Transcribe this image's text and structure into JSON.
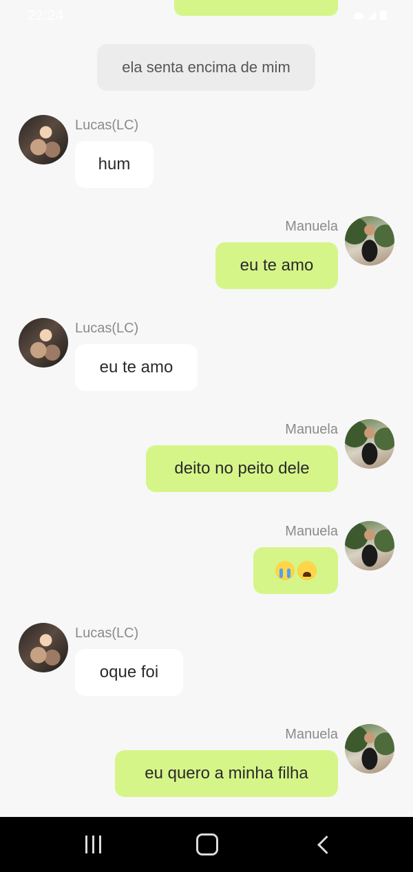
{
  "status_bar": {
    "time": "22:24",
    "icons": [
      "wifi-icon",
      "signal-icon",
      "battery-icon"
    ]
  },
  "system_message": "ela senta encima de mim",
  "messages": [
    {
      "sender": "Lucas(LC)",
      "direction": "incoming",
      "text": "hum",
      "avatar": "avatar-lucas"
    },
    {
      "sender": "Manuela",
      "direction": "outgoing",
      "text": "eu te amo",
      "avatar": "avatar-manuela"
    },
    {
      "sender": "Lucas(LC)",
      "direction": "incoming",
      "text": "eu te amo",
      "avatar": "avatar-lucas"
    },
    {
      "sender": "Manuela",
      "direction": "outgoing",
      "text": "deito no peito dele",
      "avatar": "avatar-manuela"
    },
    {
      "sender": "Manuela",
      "direction": "outgoing",
      "text": "😭😫",
      "emojis": [
        "loudly-crying-face-icon",
        "tired-face-icon"
      ],
      "avatar": "avatar-manuela"
    },
    {
      "sender": "Lucas(LC)",
      "direction": "incoming",
      "text": "oque foi",
      "avatar": "avatar-lucas"
    },
    {
      "sender": "Manuela",
      "direction": "outgoing",
      "text": "eu quero a minha filha",
      "avatar": "avatar-manuela"
    }
  ],
  "colors": {
    "background": "#f7f7f7",
    "outgoing_bubble": "#d6f589",
    "incoming_bubble": "#ffffff",
    "system_bubble": "#ececec",
    "sender_name": "#8a8a8a",
    "navbar": "#000000"
  },
  "navigation": {
    "buttons": [
      "recent-apps-icon",
      "home-icon",
      "back-icon"
    ]
  }
}
